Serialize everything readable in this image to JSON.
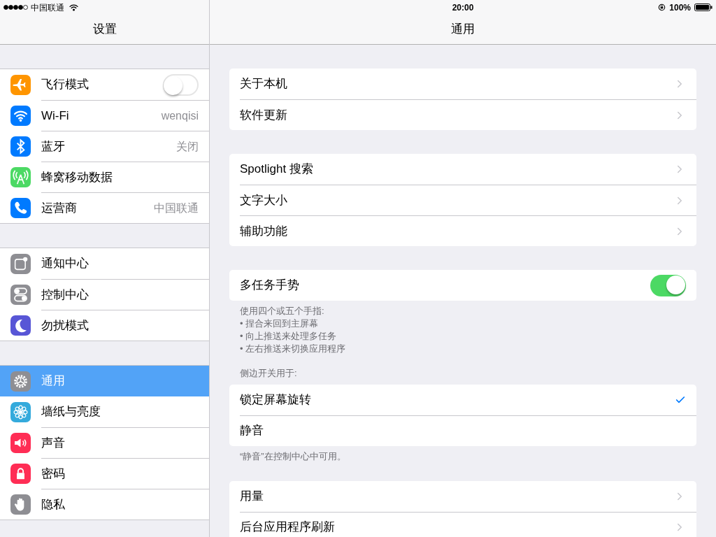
{
  "status_bar": {
    "carrier": "中国联通",
    "time": "20:00",
    "battery": "100%"
  },
  "sidebar": {
    "title": "设置",
    "groups": [
      {
        "items": [
          {
            "label": "飞行模式",
            "kind": "toggle",
            "on": false,
            "selected": false
          },
          {
            "label": "Wi-Fi",
            "kind": "value",
            "value": "wenqisi",
            "selected": false
          },
          {
            "label": "蓝牙",
            "kind": "value",
            "value": "关闭",
            "selected": false
          },
          {
            "label": "蜂窝移动数据",
            "kind": "plain",
            "selected": false
          },
          {
            "label": "运营商",
            "kind": "value",
            "value": "中国联通",
            "selected": false
          }
        ]
      },
      {
        "items": [
          {
            "label": "通知中心",
            "kind": "plain",
            "selected": false
          },
          {
            "label": "控制中心",
            "kind": "plain",
            "selected": false
          },
          {
            "label": "勿扰模式",
            "kind": "plain",
            "selected": false
          }
        ]
      },
      {
        "items": [
          {
            "label": "通用",
            "kind": "plain",
            "selected": true
          },
          {
            "label": "墙纸与亮度",
            "kind": "plain",
            "selected": false
          },
          {
            "label": "声音",
            "kind": "plain",
            "selected": false
          },
          {
            "label": "密码",
            "kind": "plain",
            "selected": false
          },
          {
            "label": "隐私",
            "kind": "plain",
            "selected": false
          }
        ]
      }
    ]
  },
  "detail": {
    "title": "通用",
    "groups": [
      {
        "rows": [
          {
            "label": "关于本机",
            "kind": "link"
          },
          {
            "label": "软件更新",
            "kind": "link"
          }
        ]
      },
      {
        "rows": [
          {
            "label": "Spotlight 搜索",
            "kind": "link"
          },
          {
            "label": "文字大小",
            "kind": "link"
          },
          {
            "label": "辅助功能",
            "kind": "link"
          }
        ]
      },
      {
        "rows": [
          {
            "label": "多任务手势",
            "kind": "toggle",
            "on": true
          }
        ],
        "footer": [
          "使用四个或五个手指:",
          "• 捏合来回到主屏幕",
          "• 向上推送来处理多任务",
          "• 左右推送来切换应用程序"
        ]
      },
      {
        "header": "侧边开关用于:",
        "rows": [
          {
            "label": "锁定屏幕旋转",
            "kind": "check",
            "checked": true
          },
          {
            "label": "静音",
            "kind": "check",
            "checked": false
          }
        ],
        "footer": [
          "“静音”在控制中心中可用。"
        ]
      },
      {
        "rows": [
          {
            "label": "用量",
            "kind": "link"
          },
          {
            "label": "后台应用程序刷新",
            "kind": "link"
          }
        ]
      }
    ]
  }
}
